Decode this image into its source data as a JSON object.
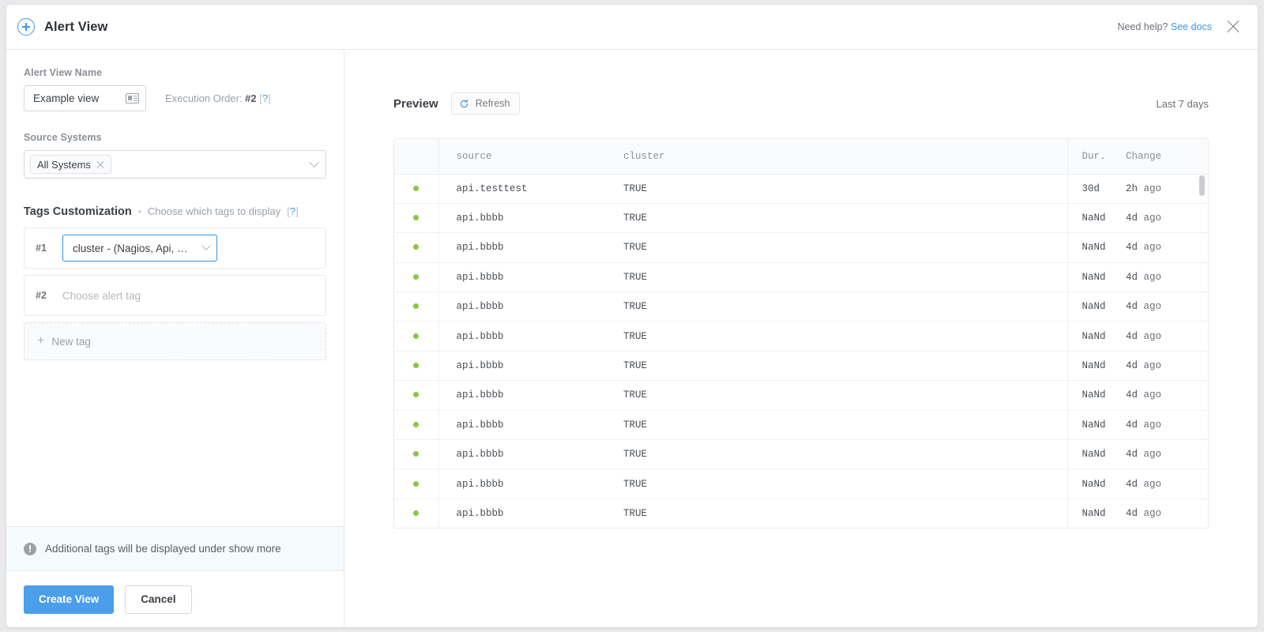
{
  "header": {
    "title": "Alert View",
    "add_icon": "plus-circle-icon",
    "need_help_text": "Need help?",
    "see_docs_label": "See docs",
    "close_icon": "close-icon"
  },
  "sidebar": {
    "name_field": {
      "label": "Alert View Name",
      "value": "Example view",
      "icon": "id-card-icon"
    },
    "execution_order": {
      "label": "Execution Order:",
      "value": "#2",
      "help": "?"
    },
    "source_systems": {
      "label": "Source Systems",
      "chips": [
        "All Systems"
      ],
      "caret_icon": "chevron-down-icon"
    },
    "tags": {
      "title": "Tags Customization",
      "separator": "•",
      "subtitle": "Choose which tags to display",
      "help": "?",
      "rows": [
        {
          "num": "#1",
          "value": "cluster - (Nagios, Api, …",
          "placeholder": "",
          "selected": true
        },
        {
          "num": "#2",
          "value": "",
          "placeholder": "Choose alert tag",
          "selected": false
        }
      ],
      "new_tag_label": "New tag",
      "new_tag_icon": "plus-icon"
    },
    "note": {
      "icon": "info-icon",
      "text": "Additional tags will be displayed under show more"
    },
    "actions": {
      "primary_label": "Create View",
      "secondary_label": "Cancel"
    }
  },
  "preview": {
    "title": "Preview",
    "refresh_label": "Refresh",
    "refresh_icon": "refresh-icon",
    "time_range": "Last 7 days",
    "table": {
      "columns": [
        "",
        "source",
        "cluster",
        "Dur.",
        "Change"
      ],
      "rows": [
        {
          "status": "ok",
          "source": "api.testtest",
          "cluster": "TRUE",
          "dur": "30d",
          "change_num": "2h",
          "change_unit": "ago"
        },
        {
          "status": "ok",
          "source": "api.bbbb",
          "cluster": "TRUE",
          "dur": "NaNd",
          "change_num": "4d",
          "change_unit": "ago"
        },
        {
          "status": "ok",
          "source": "api.bbbb",
          "cluster": "TRUE",
          "dur": "NaNd",
          "change_num": "4d",
          "change_unit": "ago"
        },
        {
          "status": "ok",
          "source": "api.bbbb",
          "cluster": "TRUE",
          "dur": "NaNd",
          "change_num": "4d",
          "change_unit": "ago"
        },
        {
          "status": "ok",
          "source": "api.bbbb",
          "cluster": "TRUE",
          "dur": "NaNd",
          "change_num": "4d",
          "change_unit": "ago"
        },
        {
          "status": "ok",
          "source": "api.bbbb",
          "cluster": "TRUE",
          "dur": "NaNd",
          "change_num": "4d",
          "change_unit": "ago"
        },
        {
          "status": "ok",
          "source": "api.bbbb",
          "cluster": "TRUE",
          "dur": "NaNd",
          "change_num": "4d",
          "change_unit": "ago"
        },
        {
          "status": "ok",
          "source": "api.bbbb",
          "cluster": "TRUE",
          "dur": "NaNd",
          "change_num": "4d",
          "change_unit": "ago"
        },
        {
          "status": "ok",
          "source": "api.bbbb",
          "cluster": "TRUE",
          "dur": "NaNd",
          "change_num": "4d",
          "change_unit": "ago"
        },
        {
          "status": "ok",
          "source": "api.bbbb",
          "cluster": "TRUE",
          "dur": "NaNd",
          "change_num": "4d",
          "change_unit": "ago"
        },
        {
          "status": "ok",
          "source": "api.bbbb",
          "cluster": "TRUE",
          "dur": "NaNd",
          "change_num": "4d",
          "change_unit": "ago"
        },
        {
          "status": "ok",
          "source": "api.bbbb",
          "cluster": "TRUE",
          "dur": "NaNd",
          "change_num": "4d",
          "change_unit": "ago"
        }
      ]
    }
  },
  "colors": {
    "accent": "#4a9eea",
    "link": "#3d9ae8",
    "status_ok": "#8cc63f",
    "note_bg": "#f5fafd"
  }
}
